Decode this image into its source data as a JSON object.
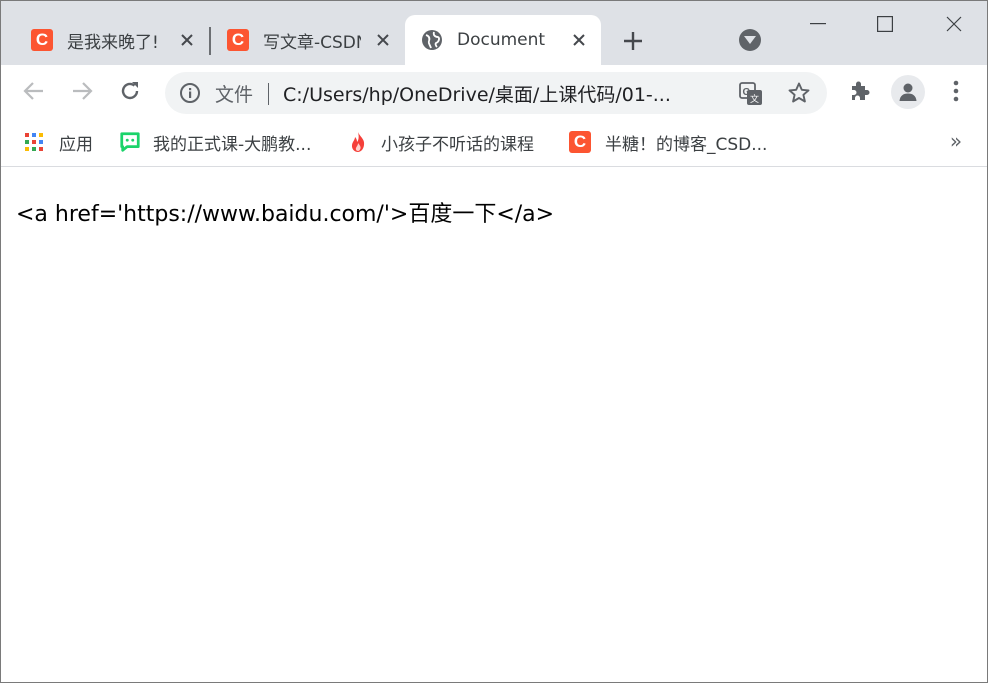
{
  "tabs": [
    {
      "title": "是我来晚了!",
      "icon": "csdn-c-icon",
      "active": false
    },
    {
      "title": "写文章-CSDN",
      "icon": "csdn-c-icon",
      "active": false
    },
    {
      "title": "Document",
      "icon": "globe-icon",
      "active": true
    }
  ],
  "omnibox": {
    "security_chip": "文件",
    "url": "C:/Users/hp/OneDrive/桌面/上课代码/01-..."
  },
  "bookmarks": [
    {
      "label": "应用",
      "icon": "apps-grid-icon"
    },
    {
      "label": "我的正式课-大鹏教...",
      "icon": "chat-bubble-icon"
    },
    {
      "label": "小孩子不听话的课程",
      "icon": "flame-icon"
    },
    {
      "label": "半糖！的博客_CSD...",
      "icon": "csdn-c-icon"
    }
  ],
  "bookmarks_overflow": "»",
  "page": {
    "text": "<a href='https://www.baidu.com/'>百度一下</a>"
  },
  "colors": {
    "tabstrip_bg": "#dee1e6",
    "csdn_brand": "#fc5531",
    "omnibox_bg": "#f1f3f4"
  }
}
